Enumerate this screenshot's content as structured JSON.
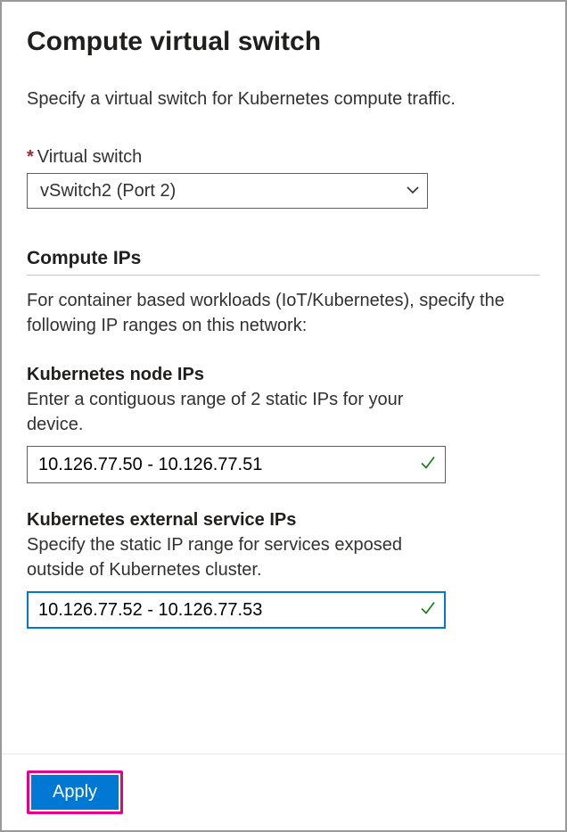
{
  "title": "Compute virtual switch",
  "description": "Specify a virtual switch for Kubernetes compute traffic.",
  "virtualSwitch": {
    "label": "Virtual switch",
    "required": "*",
    "value": "vSwitch2 (Port 2)"
  },
  "computeIps": {
    "heading": "Compute IPs",
    "description": "For container based workloads (IoT/Kubernetes), specify the following IP ranges on this network:"
  },
  "nodeIps": {
    "label": "Kubernetes node IPs",
    "description": "Enter a contiguous range of 2 static IPs for your device.",
    "value": "10.126.77.50 - 10.126.77.51"
  },
  "serviceIps": {
    "label": "Kubernetes external service IPs",
    "description": "Specify the static IP range for services exposed outside of Kubernetes cluster.",
    "value": "10.126.77.52 - 10.126.77.53"
  },
  "footer": {
    "applyLabel": "Apply"
  }
}
